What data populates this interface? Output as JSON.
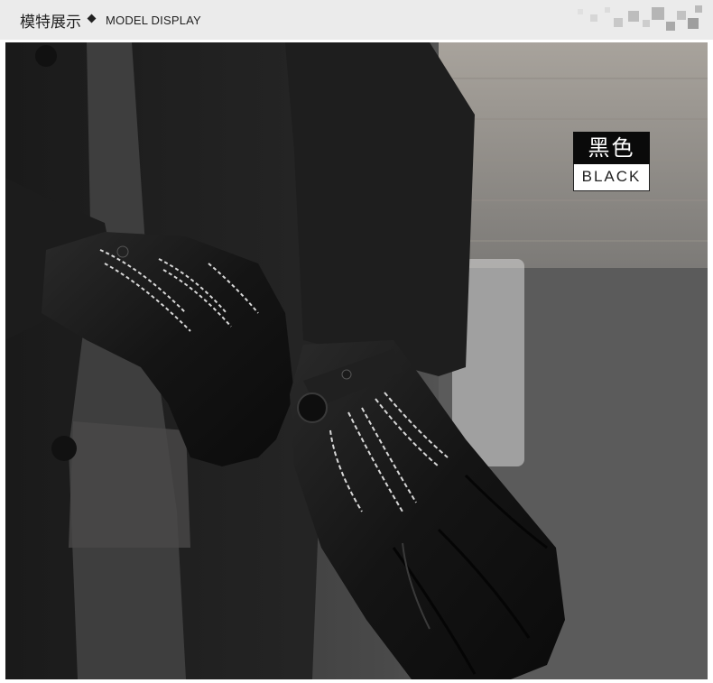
{
  "header": {
    "title_cn": "模特展示",
    "title_en": "MODEL DISPLAY",
    "separator_icon": "diamond-icon",
    "decoration_icon": "pixel-mosaic-icon"
  },
  "color_badge": {
    "name_cn": "黑色",
    "name_en": "BLACK"
  },
  "colors": {
    "header_bg": "#ebebeb",
    "badge_dark": "#0a0a0a",
    "glove": "#141414",
    "stitching": "#d8d8d8"
  }
}
